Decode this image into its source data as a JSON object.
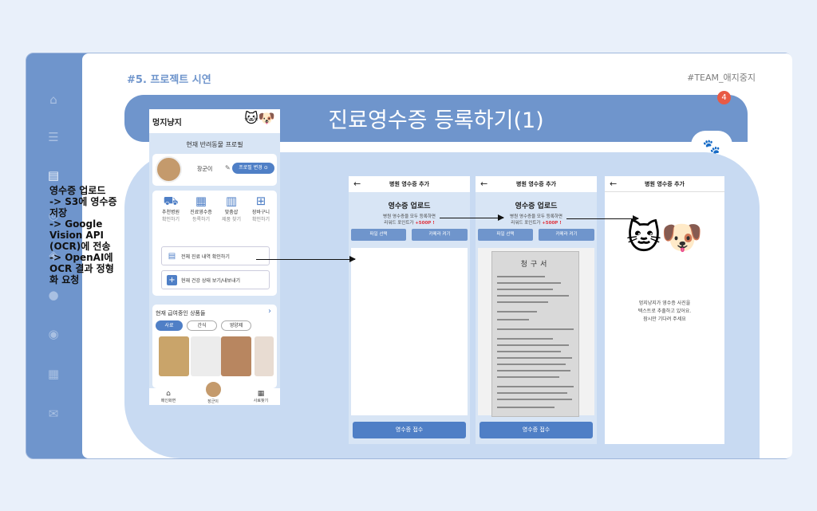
{
  "section_label": "#5. 프로젝트 시연",
  "team_label": "#TEAM_애지중지",
  "title": "진료영수증 등록하기(1)",
  "slide_number": "4",
  "description_lines": [
    "영수증 업로드",
    "-> S3에 영수증",
    "저장",
    "-> Google",
    "Vision API",
    "(OCR)에 전송",
    "-> OpenAI에",
    "OCR 결과 정형",
    "화 요청"
  ],
  "sidebar_icons": [
    "home-icon",
    "list-icon",
    "clipboard-icon",
    "search-icon",
    "layers-icon",
    "chat-icon",
    "coins-icon",
    "calendar-icon",
    "mail-icon"
  ],
  "app": {
    "name": "멍지냥지",
    "subtitle": "현재 반려동물 프로필",
    "pet_name": "장군이",
    "profile_button": "프로필 변경",
    "menu": [
      {
        "label": "추천병원",
        "sub": "확인하기"
      },
      {
        "label": "진료영수증",
        "sub": "등록하기"
      },
      {
        "label": "맞춤샵",
        "sub": "제품 찾기"
      },
      {
        "label": "장바구니",
        "sub": "확인하기"
      }
    ],
    "list_buttons": [
      "전체 진료 내역 확인하기",
      "현재 건강 상태 보기/내보내기"
    ],
    "products_title": "현재 급여중인 상품들",
    "chips": [
      "사료",
      "간식",
      "영양제"
    ],
    "nav": [
      "메인화면",
      "장군이",
      "사료찾기"
    ]
  },
  "screen": {
    "header": "병원 영수증 추가",
    "upload_title": "영수증 업로드",
    "desc_line1": "병원 영수증을 모두 등록하면",
    "desc_line2_prefix": "리워드 포인트가",
    "desc_points": "+500P !",
    "file_button": "파일 선택",
    "camera_button": "카메라 켜기",
    "submit_button": "영수증 접수",
    "receipt_title": "청구서",
    "loading_line1": "멍지냥지가 영수증 사진을",
    "loading_line2": "텍스트로 추출하고 있어요.",
    "loading_line3": "잠시만 기다려 주세요"
  }
}
